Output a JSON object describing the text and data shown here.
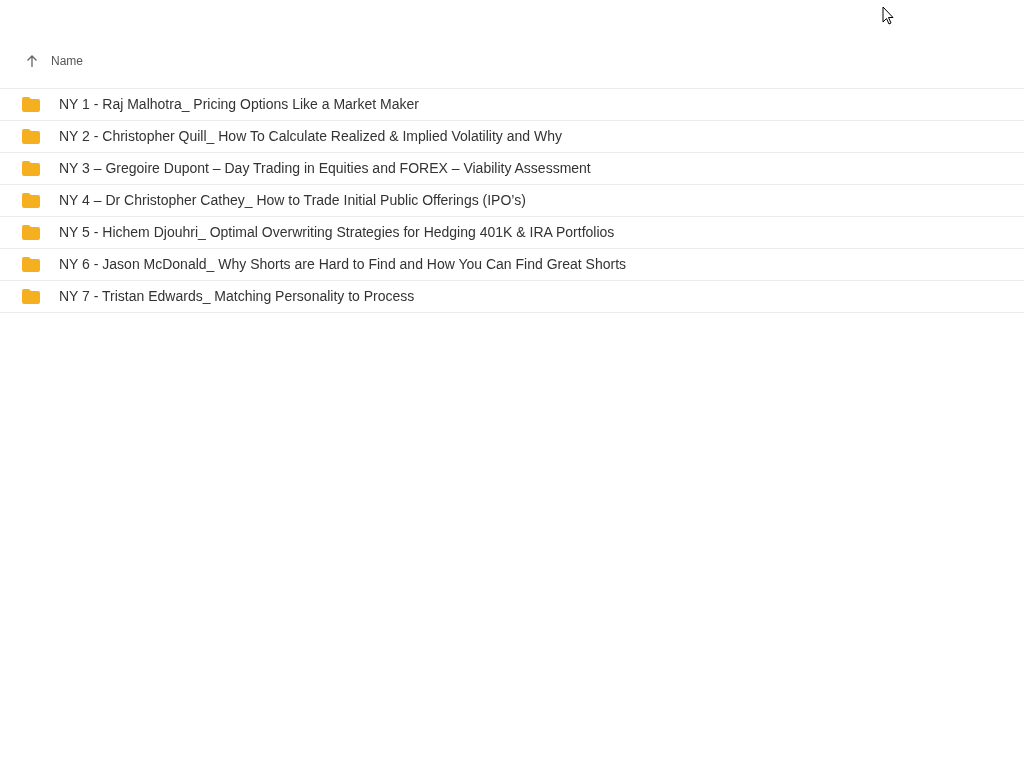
{
  "header": {
    "sort_column": "Name"
  },
  "rows": [
    {
      "name": "NY 1 - Raj Malhotra_ Pricing Options Like a Market Maker"
    },
    {
      "name": "NY 2 - Christopher Quill_ How To Calculate Realized & Implied Volatility and Why"
    },
    {
      "name": "NY 3 – Gregoire Dupont – Day Trading in Equities and FOREX – Viability Assessment"
    },
    {
      "name": "NY 4 – Dr Christopher Cathey_ How to Trade Initial Public Offerings (IPO’s)"
    },
    {
      "name": "NY 5 - Hichem Djouhri_ Optimal Overwriting Strategies for Hedging 401K & IRA Portfolios"
    },
    {
      "name": "NY 6 - Jason McDonald_ Why Shorts are Hard to Find and How You Can Find Great Shorts"
    },
    {
      "name": "NY 7 - Tristan Edwards_ Matching Personality to Process"
    }
  ]
}
